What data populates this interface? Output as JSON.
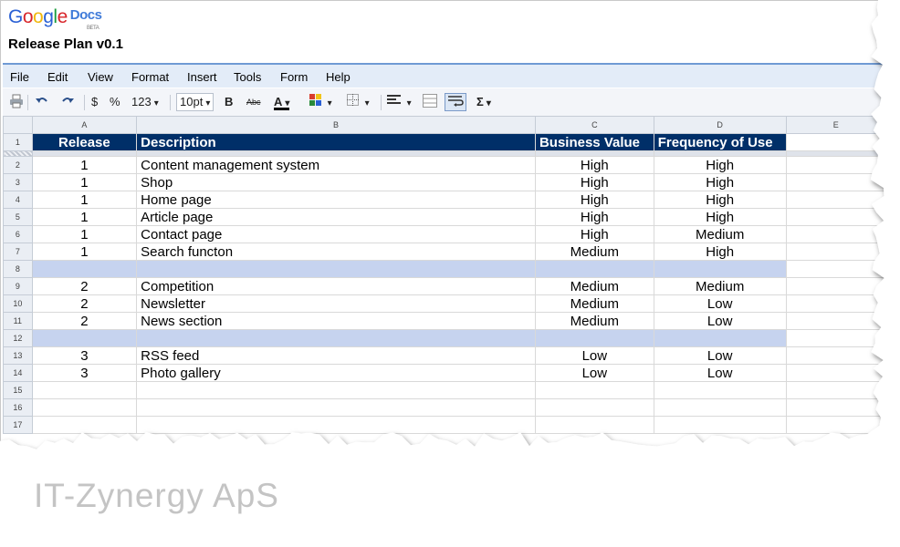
{
  "logo": {
    "google": "Google",
    "docs": "Docs",
    "beta": "BETA"
  },
  "document": {
    "title": "Release Plan v0.1"
  },
  "menu": [
    "File",
    "Edit",
    "View",
    "Format",
    "Insert",
    "Tools",
    "Form",
    "Help"
  ],
  "toolbar": {
    "currency": "$",
    "percent": "%",
    "number_format": "123",
    "font_size": "10pt",
    "bold": "B",
    "strike": "Abc",
    "text_color": "A",
    "sum": "Σ",
    "icons": [
      "print-icon",
      "undo-icon",
      "redo-icon",
      "bg-color-icon",
      "borders-icon",
      "align-icon",
      "merge-icon",
      "wrap-icon"
    ]
  },
  "grid": {
    "columns": [
      "A",
      "B",
      "C",
      "D",
      "E"
    ],
    "header_row_num": "1",
    "header": [
      "Release",
      "Description",
      "Business Value",
      "Frequency of Use"
    ],
    "rows": [
      {
        "num": "2",
        "release": "1",
        "description": "Content management system",
        "business_value": "High",
        "frequency": "High"
      },
      {
        "num": "3",
        "release": "1",
        "description": "Shop",
        "business_value": "High",
        "frequency": "High"
      },
      {
        "num": "4",
        "release": "1",
        "description": "Home page",
        "business_value": "High",
        "frequency": "High"
      },
      {
        "num": "5",
        "release": "1",
        "description": "Article page",
        "business_value": "High",
        "frequency": "High"
      },
      {
        "num": "6",
        "release": "1",
        "description": "Contact page",
        "business_value": "High",
        "frequency": "Medium"
      },
      {
        "num": "7",
        "release": "1",
        "description": "Search functon",
        "business_value": "Medium",
        "frequency": "High"
      },
      {
        "num": "8",
        "band": true
      },
      {
        "num": "9",
        "release": "2",
        "description": "Competition",
        "business_value": "Medium",
        "frequency": "Medium"
      },
      {
        "num": "10",
        "release": "2",
        "description": "Newsletter",
        "business_value": "Medium",
        "frequency": "Low"
      },
      {
        "num": "11",
        "release": "2",
        "description": "News section",
        "business_value": "Medium",
        "frequency": "Low"
      },
      {
        "num": "12",
        "band": true
      },
      {
        "num": "13",
        "release": "3",
        "description": "RSS feed",
        "business_value": "Low",
        "frequency": "Low"
      },
      {
        "num": "14",
        "release": "3",
        "description": "Photo gallery",
        "business_value": "Low",
        "frequency": "Low"
      },
      {
        "num": "15"
      },
      {
        "num": "16"
      },
      {
        "num": "17"
      }
    ]
  },
  "colors": {
    "header_bg": "#002f68",
    "band_bg": "#c6d3ef",
    "menubar_bg": "#e3ecf8"
  },
  "footer": {
    "company": "IT-Zynergy ApS"
  }
}
